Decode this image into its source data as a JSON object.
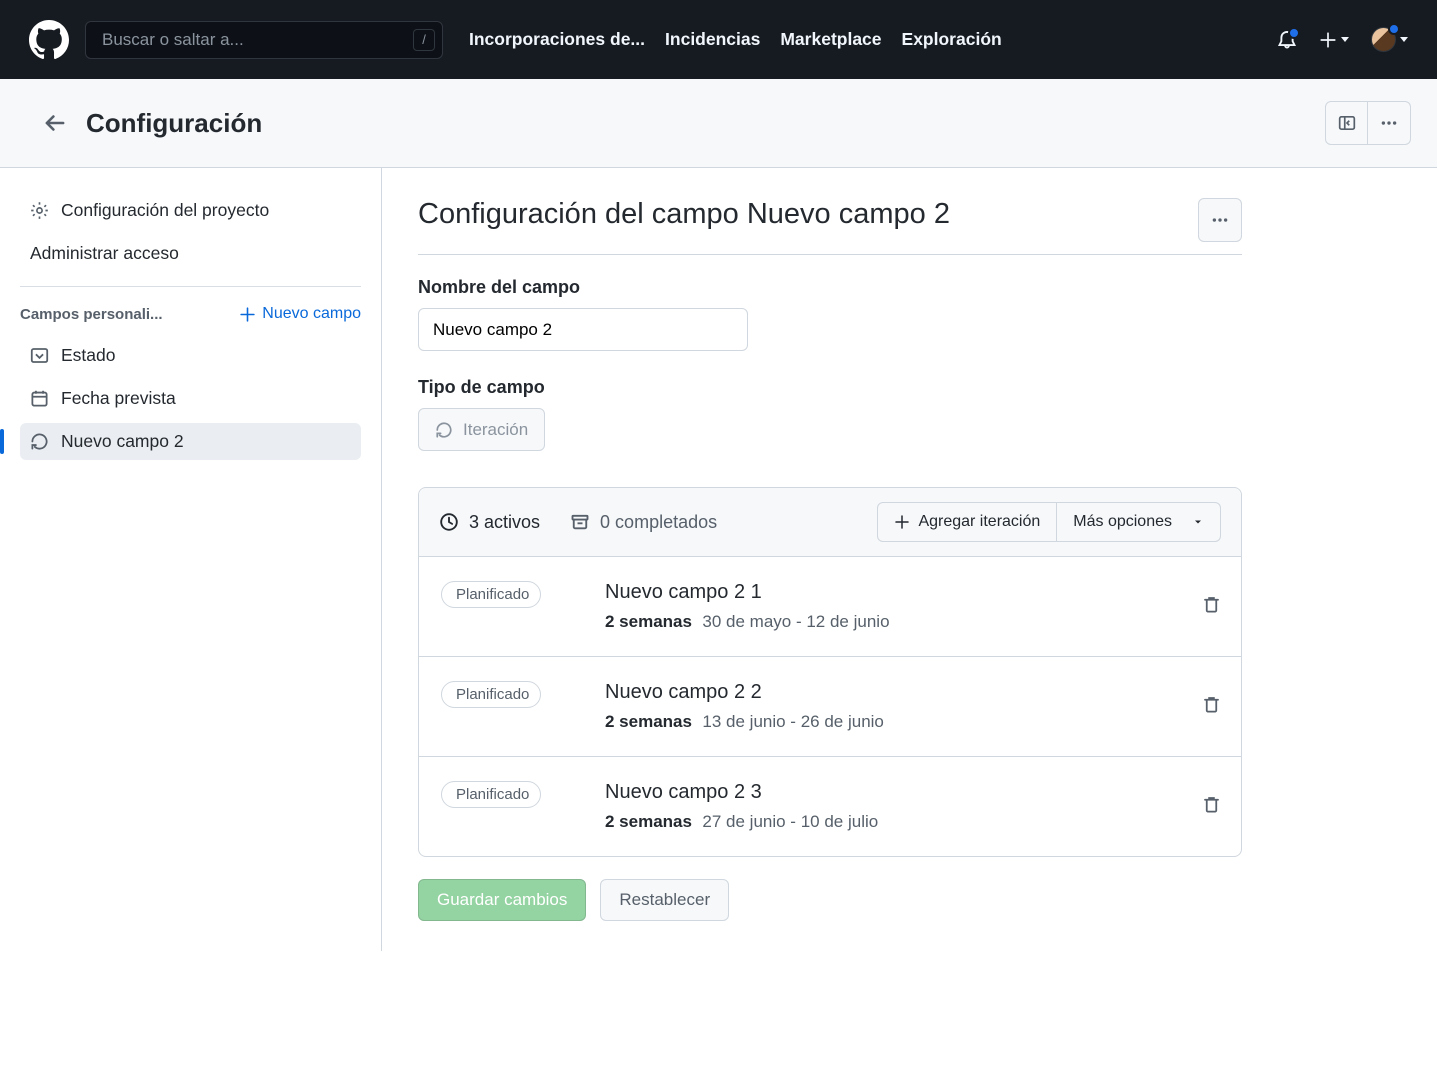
{
  "header": {
    "search_placeholder": "Buscar o saltar a...",
    "slash_key": "/",
    "nav": [
      "Incorporaciones de...",
      "Incidencias",
      "Marketplace",
      "Exploración"
    ]
  },
  "subheader": {
    "title": "Configuración"
  },
  "sidebar": {
    "project_settings": "Configuración del proyecto",
    "manage_access": "Administrar acceso",
    "custom_fields_label": "Campos personali...",
    "new_field_label": "Nuevo campo",
    "fields": [
      {
        "label": "Estado"
      },
      {
        "label": "Fecha prevista"
      },
      {
        "label": "Nuevo campo 2"
      }
    ]
  },
  "main": {
    "title": "Configuración del campo Nuevo campo 2",
    "name_label": "Nombre del campo",
    "name_value": "Nuevo campo 2",
    "type_label": "Tipo de campo",
    "type_value": "Iteración",
    "active_tab": "3 activos",
    "completed_tab": "0 completados",
    "add_iteration": "Agregar iteración",
    "more_options": "Más opciones",
    "iterations": [
      {
        "status": "Planificado",
        "title": "Nuevo campo 2 1",
        "duration": "2 semanas",
        "range": "30 de mayo - 12 de junio"
      },
      {
        "status": "Planificado",
        "title": "Nuevo campo 2 2",
        "duration": "2 semanas",
        "range": "13 de junio - 26 de junio"
      },
      {
        "status": "Planificado",
        "title": "Nuevo campo 2 3",
        "duration": "2 semanas",
        "range": "27 de junio - 10 de julio"
      }
    ],
    "save": "Guardar cambios",
    "reset": "Restablecer"
  }
}
